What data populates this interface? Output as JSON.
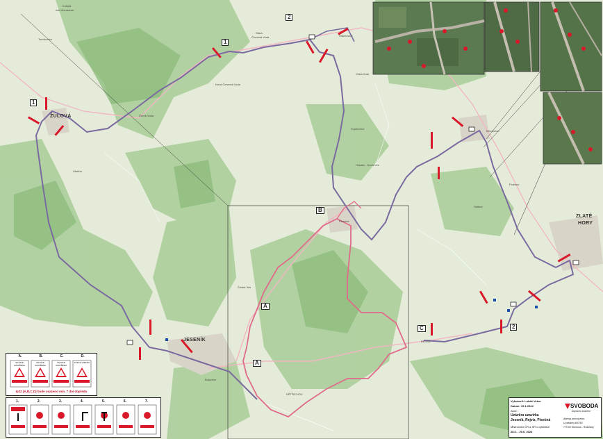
{
  "map": {
    "towns": [
      {
        "id": "zulova",
        "label": "ŽULOVÁ"
      },
      {
        "id": "jesenik",
        "label": "JESENÍK"
      },
      {
        "id": "zlate-hory-1",
        "label": "ZLATÉ"
      },
      {
        "id": "zlate-hory-2",
        "label": "HORY"
      }
    ],
    "villages": [
      {
        "id": "kobyla",
        "label": "Kobylá"
      },
      {
        "id": "vidnavka",
        "label": "nad Vidnavkou"
      },
      {
        "id": "tomikovice",
        "label": "Tomíkovice"
      },
      {
        "id": "stara-cv",
        "label": "Stará"
      },
      {
        "id": "stara-cv2",
        "label": "Červená Voda"
      },
      {
        "id": "nova-cv",
        "label": "Nová Červená Voda"
      },
      {
        "id": "cerna-voda",
        "label": "Černá Voda"
      },
      {
        "id": "uhelna",
        "label": "Uhelná"
      },
      {
        "id": "stachov",
        "label": "Stachovice"
      },
      {
        "id": "velka-kras",
        "label": "Velká Kraš"
      },
      {
        "id": "supikovice",
        "label": "Supíkovice"
      },
      {
        "id": "hradec",
        "label": "Hradec - Nová Ves"
      },
      {
        "id": "piscina",
        "label": "Písečná"
      },
      {
        "id": "ceska-ves",
        "label": "Česká Ves"
      },
      {
        "id": "mikulovice",
        "label": "Mikulovice"
      },
      {
        "id": "podvesi",
        "label": "Podvesí"
      },
      {
        "id": "salisov",
        "label": "Salisov"
      },
      {
        "id": "bukovice",
        "label": "Bukovice"
      },
      {
        "id": "detrichov",
        "label": "DĚTŘICHOV"
      },
      {
        "id": "rejvi",
        "label": "REJVÍZ"
      }
    ],
    "point_labels": [
      "A",
      "A",
      "B",
      "C",
      "1",
      "2",
      "1",
      "2"
    ],
    "colors": {
      "route_purple": "#7a6aa0",
      "route_pink": "#e06a8a",
      "road_pink": "#f0a0b4",
      "forest": "#9cc48a",
      "meadow": "#dfe9d2",
      "sign_red": "#d9192a"
    }
  },
  "legend_abcd": {
    "letters": [
      "A.",
      "B.",
      "C.",
      "D."
    ],
    "sign_text": [
      "SILNICE UZAVŘENA",
      "SILNICE UZAVŘENA",
      "SILNICE UZAVŘENA",
      "ZÁKAZ VJEZDU"
    ],
    "caption": "Ip22 (A,B,C,D) bude osazeno min. 7 dní dopředu"
  },
  "legend_numbers": {
    "numbers": [
      "1.",
      "2.",
      "3.",
      "4.",
      "5.",
      "6.",
      "7."
    ]
  },
  "title_block": {
    "made_by_label": "Vyhotovil: Lukáš Veber",
    "date_label": "Datum: 15.1.2024",
    "subject_heading": "Akce:",
    "title_line1": "Uzávěra uzavírka",
    "title_line2": "Jeseník, Rejvíz, Písečná",
    "event_line1": "Mistrovství ČR a SR v cyklistice",
    "event_line2": "28.6. - 29.6. 2024",
    "company_name": "SVOBODA",
    "company_sub": "dopravní značení",
    "address_title": "Adresa provozovny:",
    "address_line1": "U pekárny 657/15",
    "address_line2": "779 00 Olomouc - Hodolany"
  }
}
